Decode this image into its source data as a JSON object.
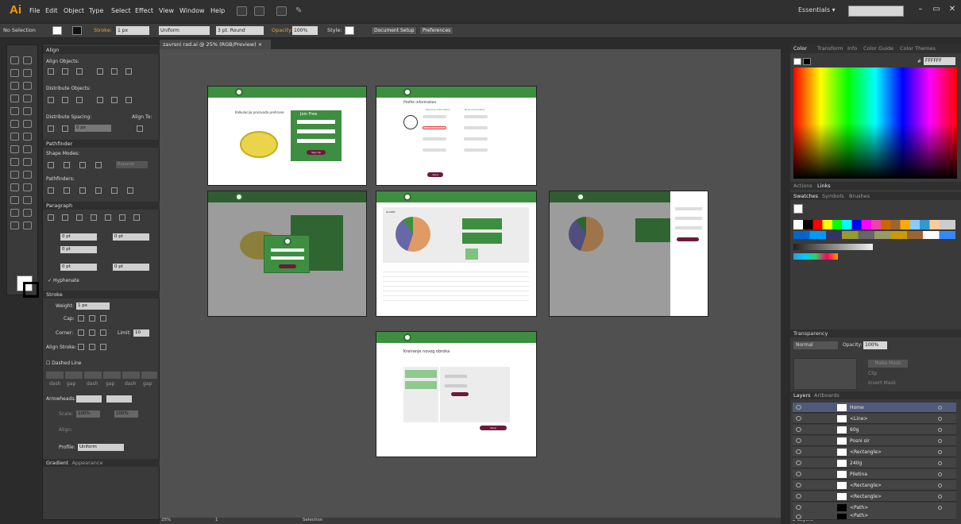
{
  "app": {
    "logo": "Ai"
  },
  "menu": [
    "File",
    "Edit",
    "Object",
    "Type",
    "Select",
    "Effect",
    "View",
    "Window",
    "Help"
  ],
  "workspace": {
    "label": "Essentials",
    "arrow": "▾"
  },
  "window_controls": [
    "–",
    "▭",
    "✕"
  ],
  "control_bar": {
    "selection": "No Selection",
    "stroke_label": "Stroke:",
    "stroke_value": "1 px",
    "profile": "Uniform",
    "brush": "3 pt. Round",
    "opacity_label": "Opacity:",
    "opacity_value": "100%",
    "style_label": "Style:",
    "doc_setup": "Document Setup",
    "preferences": "Preferences"
  },
  "document_tab": {
    "title": "zavrsni rad.ai @ 25% (RGB/Preview)",
    "close": "×"
  },
  "align_panel": {
    "title": "Align",
    "align_objects": "Align Objects:",
    "distribute_objects": "Distribute Objects:",
    "distribute_spacing": "Distribute Spacing:",
    "align_to": "Align To:",
    "spacing_value": "0 px"
  },
  "pathfinder_panel": {
    "title": "Pathfinder",
    "shape_modes": "Shape Modes:",
    "pathfinders": "Pathfinders:",
    "expand": "Expand"
  },
  "paragraph_panel": {
    "title": "Paragraph",
    "indent1": "0 pt",
    "indent2": "0 pt",
    "indent3": "0 pt",
    "space1": "0 pt",
    "space2": "0 pt",
    "hyphenate": "Hyphenate"
  },
  "stroke_panel": {
    "title": "Stroke",
    "weight_label": "Weight:",
    "weight_value": "1 px",
    "cap_label": "Cap:",
    "corner_label": "Corner:",
    "limit_label": "Limit:",
    "limit_value": "10",
    "align_label": "Align Stroke:",
    "dashed": "Dashed Line",
    "dash_labels": [
      "dash",
      "gap",
      "dash",
      "gap",
      "dash",
      "gap"
    ],
    "arrowheads": "Arrowheads:",
    "scale": "Scale:",
    "scale1": "100%",
    "scale2": "100%",
    "align2": "Align:",
    "profile_label": "Profile:",
    "profile_value": "Uniform"
  },
  "bottom_tabs": {
    "gradient": "Gradient",
    "appearance": "Appearance"
  },
  "artboards": {
    "login_title": "Kalkulacija proizvoda prehrane",
    "join_title": "Join Free",
    "username": "Username",
    "email": "Email",
    "password": "Password",
    "signup": "Sign Up",
    "profile_title": "Profile information",
    "personal_info": "Personal information",
    "body_info": "Body information",
    "save": "Save",
    "alarm_label": "ALARMI",
    "new_meal": "Kreiranje novog obroka"
  },
  "color_panel": {
    "tabs": [
      "Color",
      "Transform",
      "Info",
      "Color Guide",
      "Color Themes"
    ],
    "hex_label": "#",
    "hex": "FFFFFF"
  },
  "actions_tabs": [
    "Actions",
    "Links"
  ],
  "swatch_tabs": [
    "Swatches",
    "Symbols",
    "Brushes"
  ],
  "transparency": {
    "title": "Transparency",
    "mode": "Normal",
    "opacity_label": "Opacity:",
    "opacity_value": "100%",
    "make_mask": "Make Mask",
    "clip": "Clip",
    "invert": "Invert Mask"
  },
  "layers": {
    "tabs": [
      "Layers",
      "Artboards"
    ],
    "rows": [
      "Home",
      "<Line>",
      "60g",
      "Posni sir",
      "<Rectangle>",
      "240g",
      "Piletina",
      "<Rectangle>",
      "<Rectangle>",
      "<Path>",
      "<Path>"
    ],
    "footer": "2 Layers"
  },
  "status": {
    "zoom": "25%",
    "page": "1",
    "tool": "Selection"
  },
  "colors": {
    "green": "#3e8e41",
    "pie_orange": "#e09a63",
    "pie_purple": "#6a67a8"
  }
}
